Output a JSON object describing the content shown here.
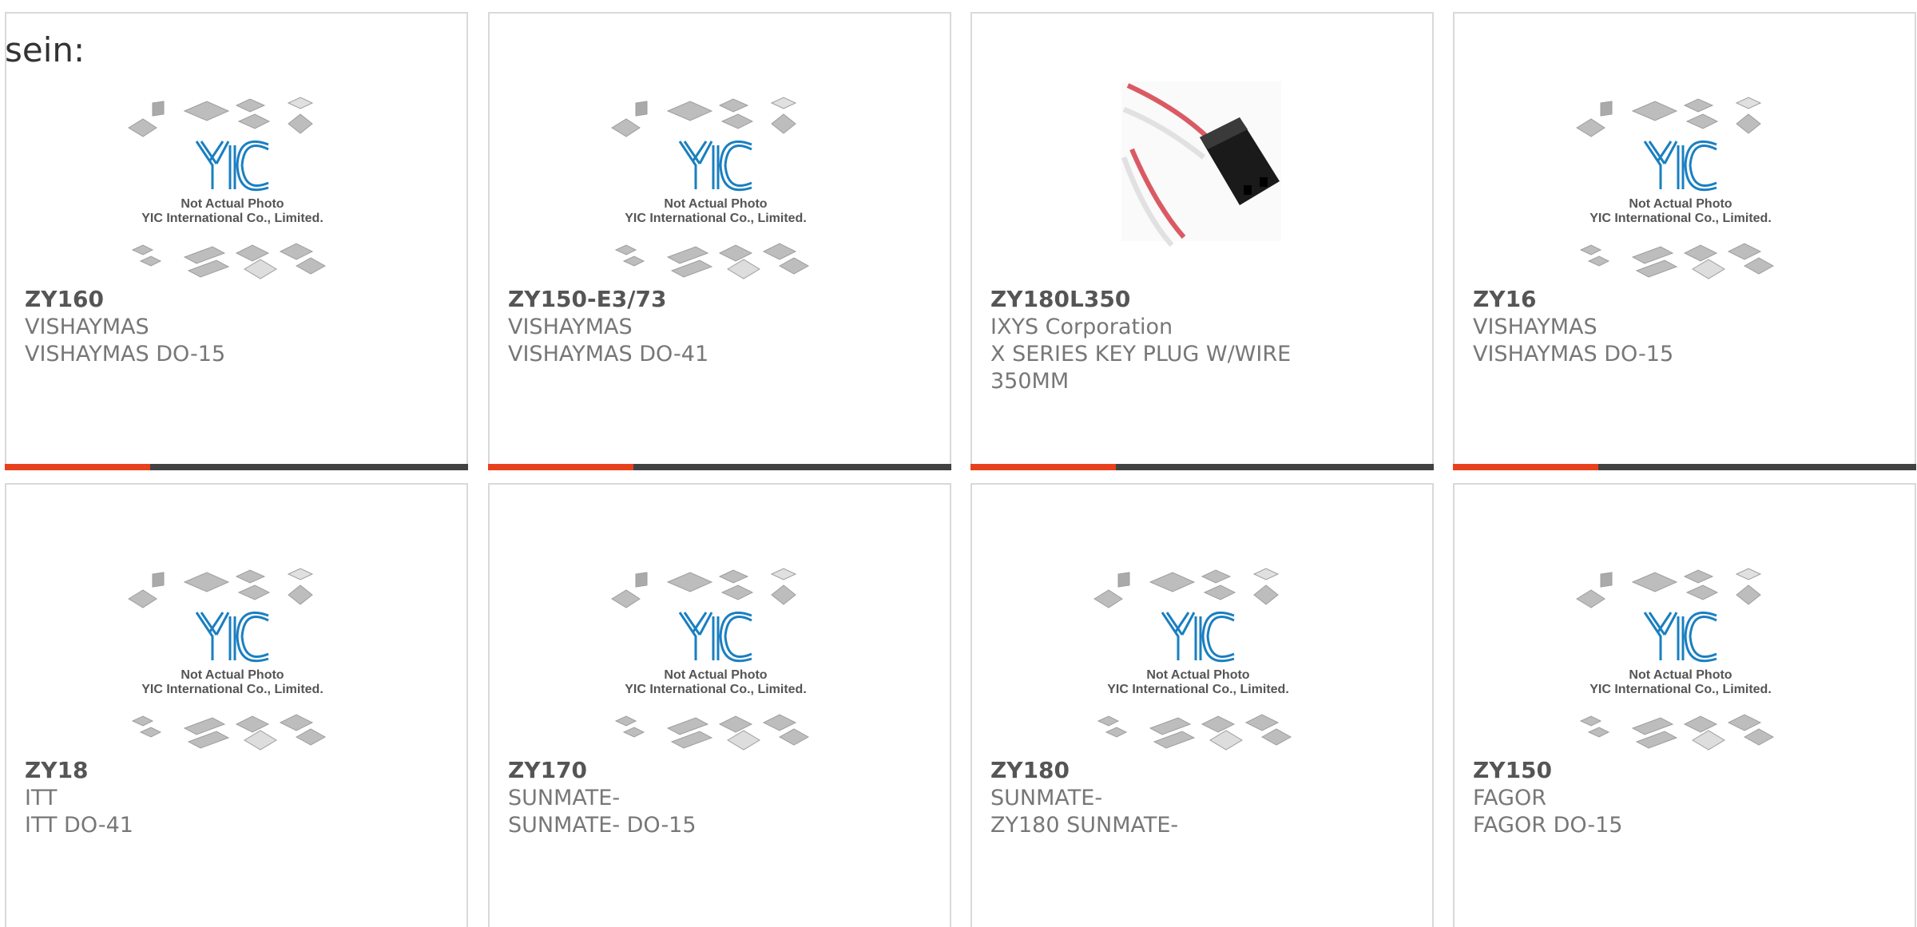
{
  "header": {
    "text": "sein:"
  },
  "colors": {
    "accent": "#e8401c",
    "bar": "#424242",
    "yic_logo": "#1a7fc1"
  },
  "placeholder": {
    "line1": "Not Actual Photo",
    "line2": "YIC International Co., Limited."
  },
  "products": [
    {
      "part_number": "ZY160",
      "manufacturer": "VISHAYMAS",
      "description": "VISHAYMAS DO-15",
      "image": "placeholder"
    },
    {
      "part_number": "ZY150-E3/73",
      "manufacturer": "VISHAYMAS",
      "description": "VISHAYMAS DO-41",
      "image": "placeholder"
    },
    {
      "part_number": "ZY180L350",
      "manufacturer": "IXYS Corporation",
      "description": "X SERIES KEY PLUG W/WIRE 350MM",
      "image": "photo"
    },
    {
      "part_number": "ZY16",
      "manufacturer": "VISHAYMAS",
      "description": "VISHAYMAS DO-15",
      "image": "placeholder"
    },
    {
      "part_number": "ZY18",
      "manufacturer": "ITT",
      "description": "ITT DO-41",
      "image": "placeholder"
    },
    {
      "part_number": "ZY170",
      "manufacturer": "SUNMATE-",
      "description": "SUNMATE- DO-15",
      "image": "placeholder"
    },
    {
      "part_number": "ZY180",
      "manufacturer": "SUNMATE-",
      "description": "ZY180 SUNMATE-",
      "image": "placeholder"
    },
    {
      "part_number": "ZY150",
      "manufacturer": "FAGOR",
      "description": "FAGOR DO-15",
      "image": "placeholder"
    }
  ]
}
